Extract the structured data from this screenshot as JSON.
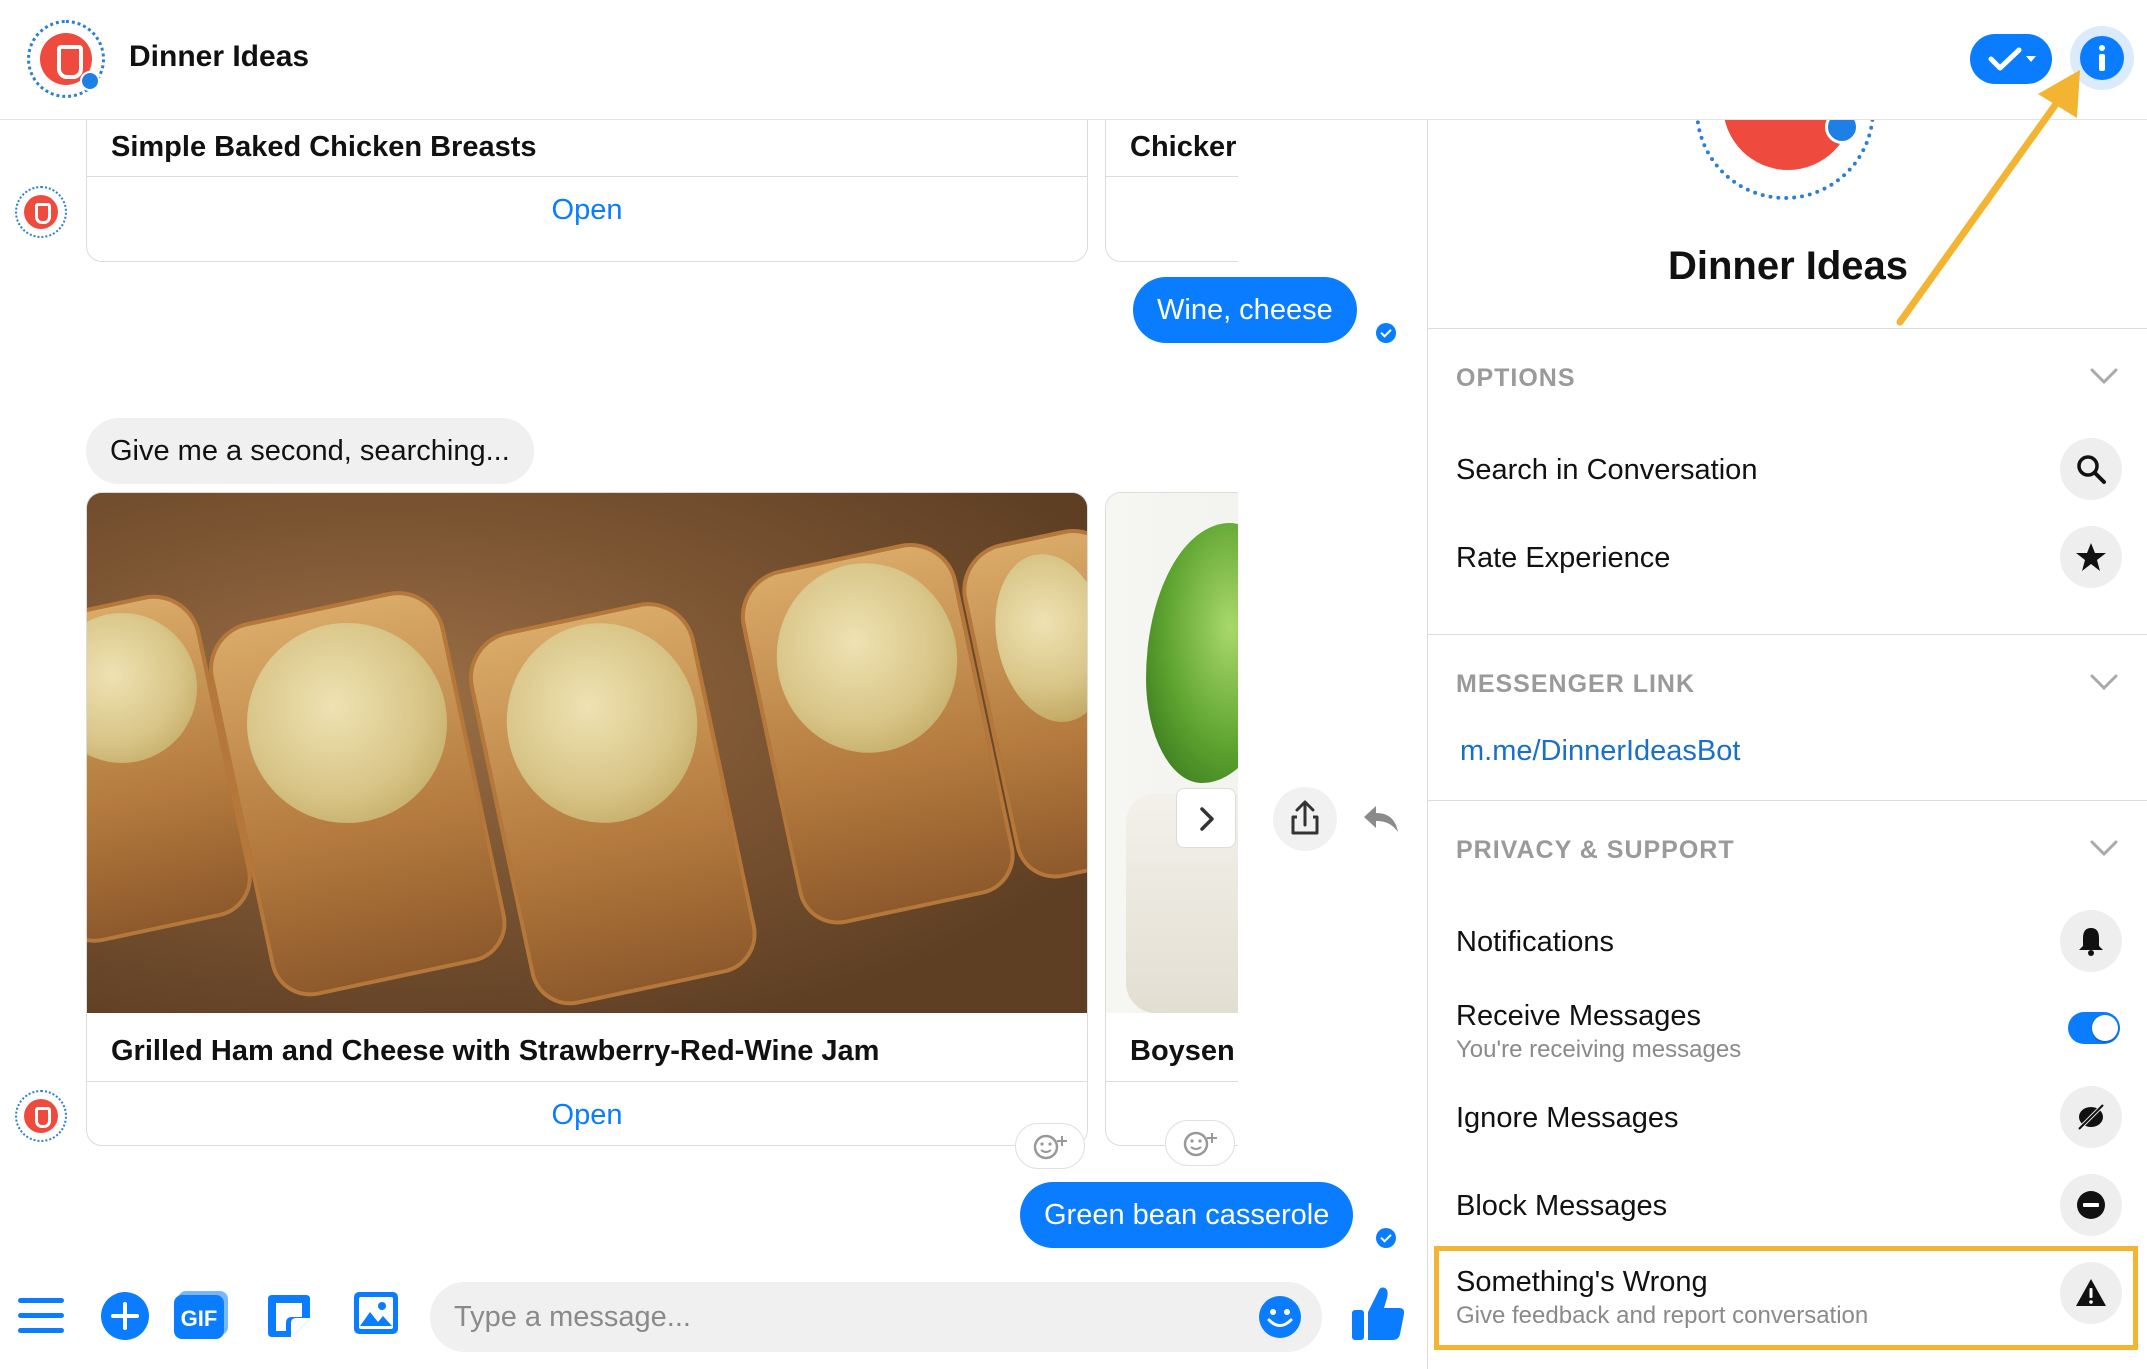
{
  "header": {
    "title": "Dinner Ideas"
  },
  "chat": {
    "top_card_1": {
      "title": "Simple Baked Chicken Breasts",
      "button": "Open"
    },
    "top_card_2": {
      "title": "Chicker"
    },
    "outgoing_1": "Wine, cheese",
    "incoming_1": "Give me a second, searching...",
    "card_1": {
      "title": "Grilled Ham and Cheese with Strawberry-Red-Wine Jam",
      "button": "Open"
    },
    "card_2": {
      "title": "Boysen"
    },
    "outgoing_2": "Green bean casserole"
  },
  "composer": {
    "placeholder": "Type a message..."
  },
  "panel": {
    "name": "Dinner Ideas",
    "options": {
      "heading": "OPTIONS",
      "items": [
        {
          "label": "Search in Conversation",
          "icon": "search-icon"
        },
        {
          "label": "Rate Experience",
          "icon": "star-icon"
        }
      ]
    },
    "messenger_link": {
      "heading": "MESSENGER LINK",
      "link": "m.me/DinnerIdeasBot"
    },
    "privacy": {
      "heading": "PRIVACY & SUPPORT",
      "notifications": "Notifications",
      "receive": {
        "label": "Receive Messages",
        "sub": "You're receiving messages"
      },
      "ignore": "Ignore Messages",
      "block": "Block Messages",
      "wrong": {
        "label": "Something's Wrong",
        "sub": "Give feedback and report conversation"
      }
    }
  },
  "colors": {
    "accent": "#0a7cff",
    "highlight": "#f3b431",
    "brand_red": "#ee4b3e"
  }
}
